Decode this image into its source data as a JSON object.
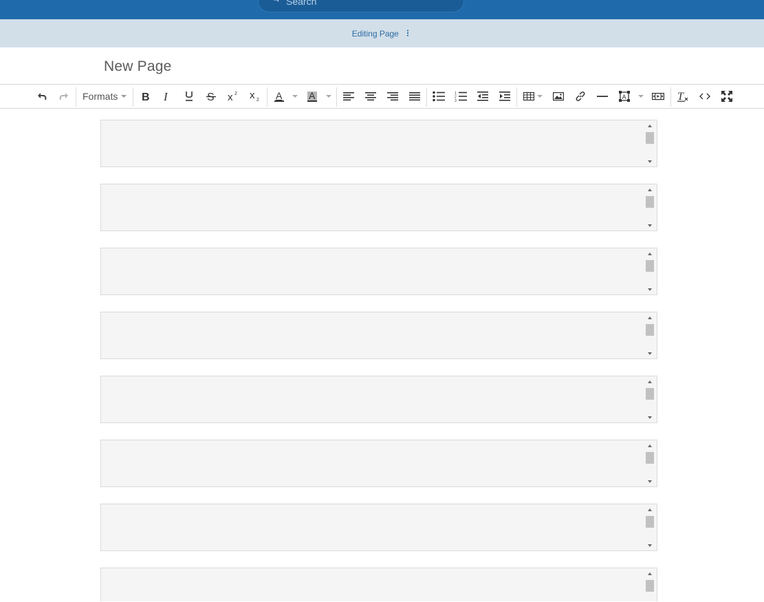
{
  "header": {
    "search": {
      "placeholder": "Search",
      "icon": "search-icon"
    }
  },
  "subbar": {
    "editing_label": "Editing Page",
    "menu_icon": "kebab-menu-icon"
  },
  "page": {
    "title": "New Page"
  },
  "toolbar": {
    "formats_label": "Formats",
    "buttons": [
      "undo-icon",
      "redo-icon",
      "bold-icon",
      "italic-icon",
      "underline-icon",
      "strikethrough-icon",
      "superscript-icon",
      "subscript-icon",
      "text-color-icon",
      "background-color-icon",
      "align-left-icon",
      "align-center-icon",
      "align-right-icon",
      "align-justify-icon",
      "bullet-list-icon",
      "numbered-list-icon",
      "outdent-icon",
      "indent-icon",
      "table-icon",
      "image-icon",
      "link-icon",
      "horizontal-rule-icon",
      "text-box-icon",
      "media-icon",
      "clear-formatting-icon",
      "source-code-icon",
      "fullscreen-icon"
    ]
  },
  "content_blocks": [
    {
      "value": ""
    },
    {
      "value": ""
    },
    {
      "value": ""
    },
    {
      "value": ""
    },
    {
      "value": ""
    },
    {
      "value": ""
    },
    {
      "value": ""
    },
    {
      "value": ""
    }
  ],
  "colors": {
    "header_blue": "#1f6aab",
    "subbar_bg": "#d2dfe9",
    "link_blue": "#2d6aa3",
    "block_bg": "#f5f5f5"
  }
}
